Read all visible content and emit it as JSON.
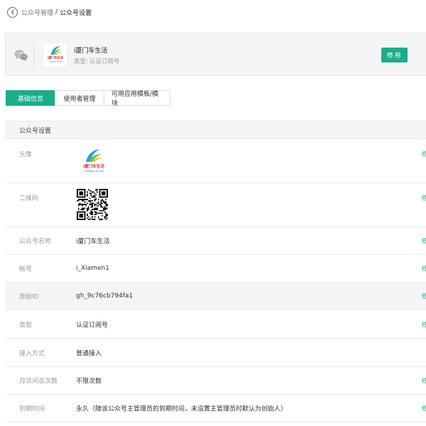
{
  "breadcrumb": {
    "parent": "公众号管理",
    "separator": "/",
    "current": "公众号设置"
  },
  "account": {
    "name": "i厦门车生活",
    "type_label": "类型:",
    "type_value": "认证订阅号",
    "disable_label": "停用"
  },
  "logo": {
    "main_text": "i厦门车生活",
    "sub_text": "i Xiamen car life"
  },
  "tabs": [
    {
      "label": "基础信息",
      "active": true
    },
    {
      "label": "使用者管理",
      "active": false
    },
    {
      "label": "可用应用模板/模块",
      "active": false
    }
  ],
  "section": {
    "title": "公众号设置",
    "edit_label": "修",
    "rows": [
      {
        "label": "头像",
        "value": ""
      },
      {
        "label": "二维码",
        "value": ""
      },
      {
        "label": "公众号名称",
        "value": "i厦门车生活"
      },
      {
        "label": "帐号",
        "value": "i_Xiamen1"
      },
      {
        "label": "原始ID",
        "value": "gh_9c76cb794fa1"
      },
      {
        "label": "类型",
        "value": "认证订阅号"
      },
      {
        "label": "接入方式",
        "value": "普通接入"
      },
      {
        "label": "月访问总次数",
        "value": "不限次数"
      },
      {
        "label": "到期时间",
        "value": "永久（随该公众号主管理员的到期时间，未设置主管理员时默认为创始人）"
      }
    ]
  },
  "colors": {
    "accent": "#1aad8a",
    "panel": "#f4f5f7"
  }
}
